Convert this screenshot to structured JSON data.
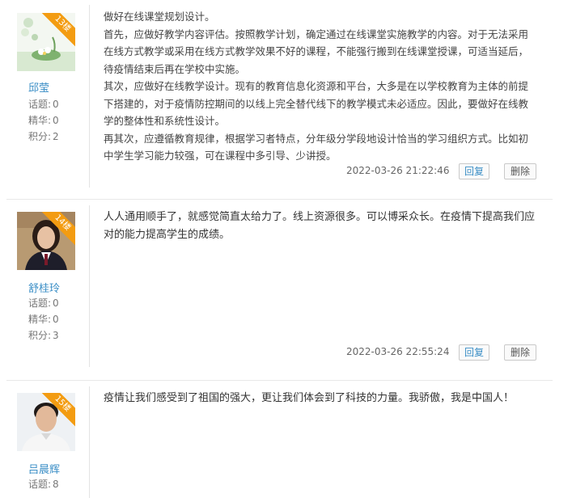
{
  "posts": [
    {
      "floor": "13楼",
      "username": "邱莹",
      "stats": [
        {
          "label": "话题:",
          "value": "0"
        },
        {
          "label": "精华:",
          "value": "0"
        },
        {
          "label": "积分:",
          "value": "2"
        }
      ],
      "paragraphs": [
        "做好在线课堂规划设计。",
        "首先，应做好教学内容评估。按照教学计划，确定通过在线课堂实施教学的内容。对于无法采用在线方式教学或采用在线方式教学效果不好的课程，不能强行搬到在线课堂授课，可适当延后，待疫情结束后再在学校中实施。",
        "其次，应做好在线教学设计。现有的教育信息化资源和平台，大多是在以学校教育为主体的前提下搭建的，对于疫情防控期间的以线上完全替代线下的教学模式未必适应。因此，要做好在线教学的整体性和系统性设计。",
        "再其次，应遵循教育规律，根据学习者特点，分年级分学段地设计恰当的学习组织方式。比如初中学生学习能力较强，可在课程中多引导、少讲授。"
      ],
      "timestamp": "2022-03-26 21:22:46",
      "reply_label": "回复",
      "delete_label": "删除"
    },
    {
      "floor": "14楼",
      "username": "舒桂玲",
      "stats": [
        {
          "label": "话题:",
          "value": "0"
        },
        {
          "label": "精华:",
          "value": "0"
        },
        {
          "label": "积分:",
          "value": "3"
        }
      ],
      "paragraphs": [
        "人人通用顺手了，就感觉简直太给力了。线上资源很多。可以博采众长。在疫情下提高我们应对的能力提高学生的成绩。"
      ],
      "timestamp": "2022-03-26 22:55:24",
      "reply_label": "回复",
      "delete_label": "删除"
    },
    {
      "floor": "15楼",
      "username": "吕晨辉",
      "stats": [
        {
          "label": "话题:",
          "value": "8"
        }
      ],
      "paragraphs": [
        "疫情让我们感受到了祖国的强大，更让我们体会到了科技的力量。我骄傲，我是中国人！"
      ]
    }
  ]
}
